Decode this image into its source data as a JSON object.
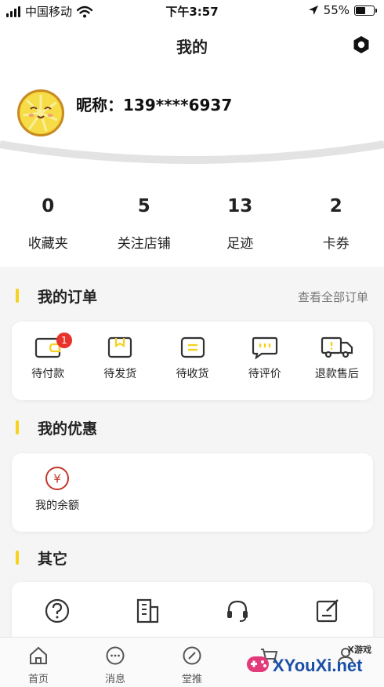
{
  "status_bar": {
    "carrier": "中国移动",
    "time": "下午3:57",
    "battery": "55%",
    "battery_level": 0.55
  },
  "nav": {
    "title": "我的"
  },
  "profile": {
    "nickname": "昵称：139****6937"
  },
  "stats": [
    {
      "count": "0",
      "label": "收藏夹"
    },
    {
      "count": "5",
      "label": "关注店铺"
    },
    {
      "count": "13",
      "label": "足迹"
    },
    {
      "count": "2",
      "label": "卡券"
    }
  ],
  "orders": {
    "title": "我的订单",
    "view_all": "查看全部订单",
    "items": [
      {
        "label": "待付款",
        "icon": "wallet-icon",
        "badge": "1"
      },
      {
        "label": "待发货",
        "icon": "package-icon"
      },
      {
        "label": "待收货",
        "icon": "receive-icon"
      },
      {
        "label": "待评价",
        "icon": "comment-icon"
      },
      {
        "label": "退款售后",
        "icon": "truck-icon"
      }
    ]
  },
  "benefits": {
    "title": "我的优惠",
    "items": [
      {
        "label": "我的余额",
        "icon": "yen-icon"
      }
    ]
  },
  "others": {
    "title": "其它",
    "items": [
      {
        "icon": "help-icon"
      },
      {
        "icon": "building-icon"
      },
      {
        "icon": "headset-icon"
      },
      {
        "icon": "edit-icon"
      }
    ]
  },
  "tab_bar": [
    {
      "label": "首页",
      "icon": "home-icon"
    },
    {
      "label": "消息",
      "icon": "message-icon"
    },
    {
      "label": "堂推",
      "icon": "compass-icon"
    },
    {
      "label": "",
      "icon": "cart-icon"
    },
    {
      "label": "",
      "icon": "user-icon"
    }
  ],
  "watermark": {
    "text": "XYouXi.net",
    "small": "X游戏"
  },
  "colors": {
    "accent": "#f5d21d",
    "badge": "#e8322b",
    "icon": "#333333",
    "yen": "#c0392b"
  }
}
